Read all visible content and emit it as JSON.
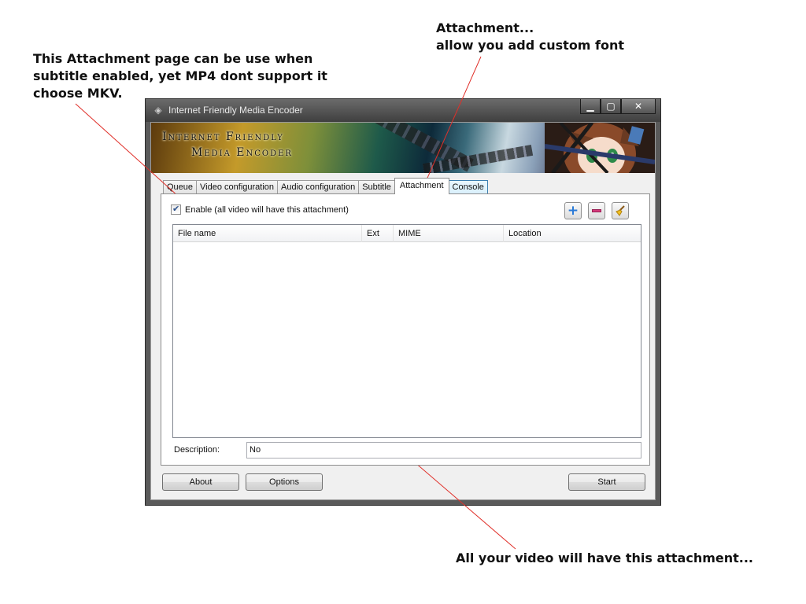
{
  "annotations": {
    "left": [
      "This Attachment page can be use when",
      "subtitle enabled, yet MP4 dont support it",
      "choose MKV."
    ],
    "top": [
      "Attachment...",
      "allow you add custom font"
    ],
    "bottom": "All your video will have this attachment..."
  },
  "window": {
    "title": "Internet Friendly Media Encoder",
    "controls": {
      "minimize": "▁",
      "maximize": "▢",
      "close": "✕"
    }
  },
  "banner": {
    "line1": "Internet Friendly",
    "line2": "Media Encoder"
  },
  "tabs": [
    "Queue",
    "Video configuration",
    "Audio configuration",
    "Subtitle",
    "Attachment",
    "Console"
  ],
  "active_tab": "Attachment",
  "attachment": {
    "enable_label": "Enable (all video will have this attachment)",
    "enable_checked": true,
    "toolbar_icons": [
      "add-icon",
      "remove-icon",
      "clear-broom-icon"
    ],
    "columns": [
      "File name",
      "Ext",
      "MIME",
      "Location"
    ],
    "rows": [],
    "description_label": "Description:",
    "description_value": "No"
  },
  "buttons": {
    "about": "About",
    "options": "Options",
    "start": "Start"
  },
  "colors": {
    "tab_hover_border": "#3c7fb1",
    "add_icon": "#2a7ad8",
    "remove_icon": "#d23a7a",
    "annotation_line": "#e0302a"
  }
}
